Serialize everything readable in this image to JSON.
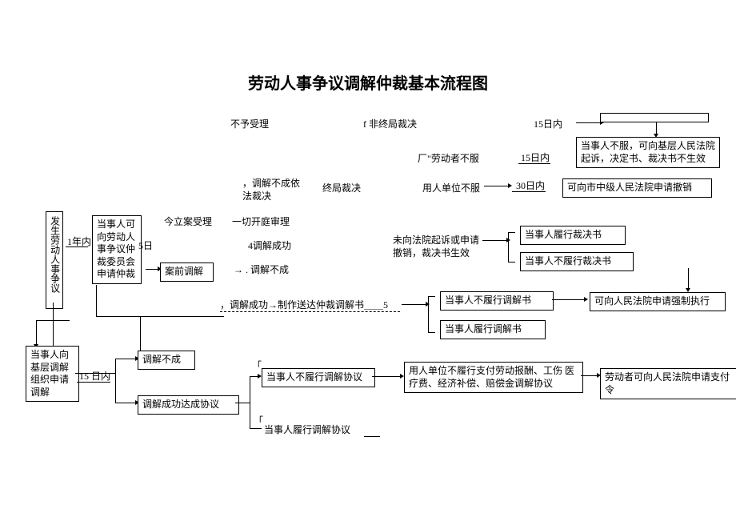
{
  "title": "劳动人事争议调解仲裁基本流程图",
  "labels": {
    "reject": "不予受理",
    "nonfinal": "f 非终局裁决",
    "d15a": "15日内",
    "worker_unsatisfied": "厂\"劳动者不服",
    "d15b": "15日内",
    "mediate_fail_law": "，调解不成依\n法裁决",
    "final_ruling": "终局裁决",
    "employer_unsatisfied": "用人单位不服",
    "d30": "30日内",
    "dispute_happen": "发生劳动人事争议",
    "y1": "1年内",
    "accept_case": "今立案受理",
    "hearing": "一切开庭审理",
    "d5": "5日",
    "mediate_success_4": "4调解成功",
    "pre_mediate": "案前调解",
    "mediate_fail_arrow": "→ . 调解不成",
    "mediate_success_make": "，调解成功→制作送达仲裁调解书＿＿5",
    "no_sue": "未向法院起诉或申请\n撤销，裁决书生效",
    "d15c": "15 日内",
    "lbracket": "「",
    "lbracket2": "「"
  },
  "boxes": {
    "disagree_basic": "当事人不服，可向基层人民法院\n起诉，决定书、裁决书不生效",
    "apply_revoke": "可向市中级人民法院申请撤销",
    "apply_arbitration": "当事人可\n向劳动人\n事争议仲\n裁委员会\n申请仲裁",
    "perform_ruling": "当事人履行裁决书",
    "not_perform_ruling": "当事人不履行裁决书",
    "not_perform_mediate_doc": "当事人不履行调解书",
    "perform_mediate_doc": "当事人履行调解书",
    "force_execute": "可向人民法院申请强制执行",
    "apply_mediate": "当事人向\n基层调解\n组织申请\n调解",
    "mediate_fail": "调解不成",
    "mediate_success_agree": "调解成功达成协议",
    "not_perform_agree": "当事人不履行调解协议",
    "perform_agree": "当事人履行调解协议",
    "employer_not_pay": "用人单位不履行支付劳动报酬、工伤\n医疗费、经济补偿、赔偿金调解协议",
    "pay_order": "劳动者可向人民法院申请支付令"
  }
}
